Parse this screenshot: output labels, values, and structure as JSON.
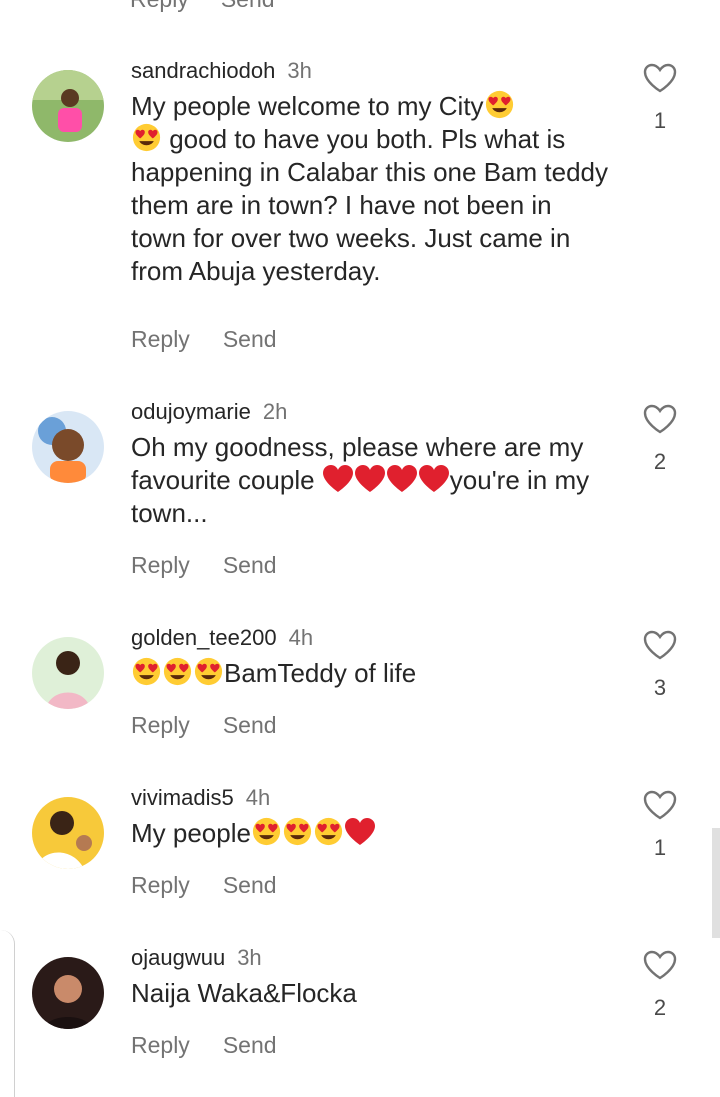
{
  "top_actions": {
    "reply": "Reply",
    "send": "Send"
  },
  "comments": [
    {
      "username": "sandrachiodoh",
      "time": "3h",
      "text_1": "My people welcome to my City",
      "text_2": " good to have you both. Pls what is happening in Calabar this one Bam teddy them are in town? I have not been in town for over two weeks. Just came in from Abuja yesterday.",
      "likes": "1",
      "reply_label": "Reply",
      "send_label": "Send"
    },
    {
      "username": "odujoymarie",
      "time": "2h",
      "text_1": "Oh my goodness, please where are my favourite couple ",
      "text_2": "you're in my town...",
      "likes": "2",
      "reply_label": "Reply",
      "send_label": "Send"
    },
    {
      "username": "golden_tee200",
      "time": "4h",
      "text_1": "BamTeddy of life",
      "likes": "3",
      "reply_label": "Reply",
      "send_label": "Send"
    },
    {
      "username": "vivimadis5",
      "time": "4h",
      "text_1": "My people",
      "likes": "1",
      "reply_label": "Reply",
      "send_label": "Send"
    },
    {
      "username": "ojaugwuu",
      "time": "3h",
      "text_1": "Naija Waka&Flocka",
      "likes": "2",
      "reply_label": "Reply",
      "send_label": "Send"
    }
  ],
  "icons": {
    "like": "heart-outline-icon",
    "heart_eyes": "heart-eyes-emoji",
    "red_heart": "red-heart-emoji"
  },
  "colors": {
    "muted": "#737373",
    "text": "#262626",
    "emoji_heart": "#e0202e",
    "emoji_face": "#ffcc33"
  }
}
